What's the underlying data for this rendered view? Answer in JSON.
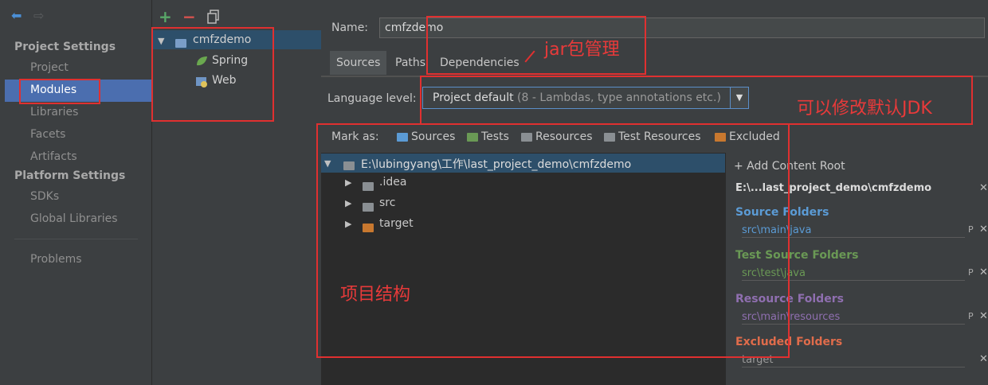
{
  "toolbar": {
    "add": "+",
    "remove": "−",
    "copy": "copy"
  },
  "sidebar": {
    "project_settings_title": "Project Settings",
    "project_items": [
      "Project",
      "Modules",
      "Libraries",
      "Facets",
      "Artifacts"
    ],
    "platform_settings_title": "Platform Settings",
    "platform_items": [
      "SDKs",
      "Global Libraries"
    ],
    "problems": "Problems",
    "selected": "Modules"
  },
  "modules": {
    "root": "cmfzdemo",
    "facets": [
      "Spring",
      "Web"
    ]
  },
  "main": {
    "name_label": "Name:",
    "name_value": "cmfzdemo",
    "tabs": [
      "Sources",
      "Paths",
      "Dependencies"
    ],
    "active_tab": "Sources",
    "language_label": "Language level:",
    "language_value": "Project default",
    "language_detail": " (8 - Lambdas, type annotations etc.)",
    "mark_as": "Mark as:",
    "mark_items": [
      "Sources",
      "Tests",
      "Resources",
      "Test Resources",
      "Excluded"
    ],
    "content_root": "E:\\lubingyang\\工作\\last_project_demo\\cmfzdemo",
    "children": [
      ".idea",
      "src",
      "target"
    ]
  },
  "roots_panel": {
    "add": "+ Add Content Root",
    "root_short": "E:\\...last_project_demo\\cmfzdemo",
    "sections": [
      {
        "title": "Source Folders",
        "path": "src\\main\\java"
      },
      {
        "title": "Test Source Folders",
        "path": "src\\test\\java"
      },
      {
        "title": "Resource Folders",
        "path": "src\\main\\resources"
      },
      {
        "title": "Excluded Folders",
        "path": "target"
      }
    ]
  },
  "annotations": {
    "jar": "jar包管理",
    "jdk": "可以修改默认JDK",
    "structure": "项目结构"
  },
  "colors": {
    "accent": "#4b6eaf",
    "annotation_red": "#e03030",
    "source_blue": "#5b9bd5",
    "test_green": "#6a9955",
    "resource_purple": "#8f6fb0",
    "excluded_orange": "#e06c4b"
  }
}
